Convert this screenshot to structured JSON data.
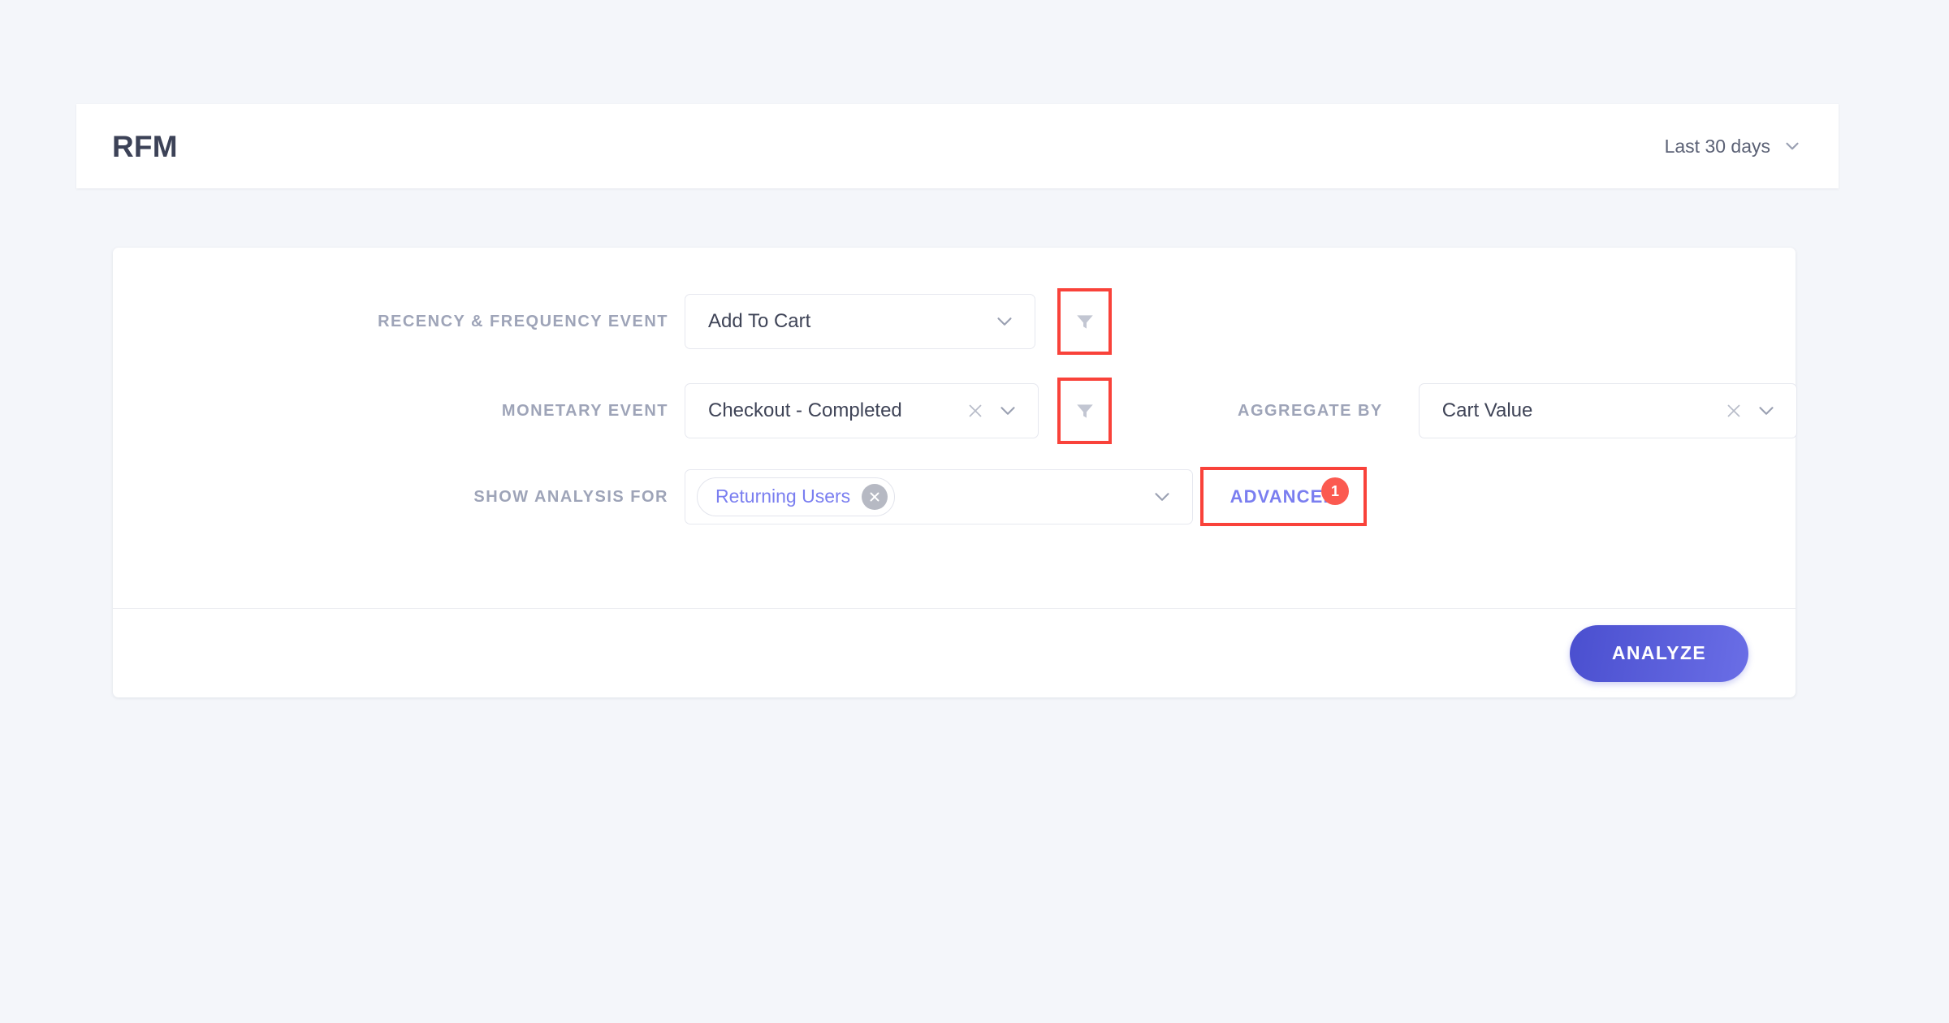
{
  "header": {
    "title": "RFM",
    "date_range": "Last 30 days",
    "date_range_icon": "chevron-down-icon"
  },
  "form": {
    "rows": [
      {
        "label": "RECENCY & FREQUENCY EVENT",
        "select_value": "Add To Cart",
        "has_clear": false,
        "filter_icon": "filter-funnel-icon",
        "filter_highlighted": true
      },
      {
        "label": "MONETARY EVENT",
        "select_value": "Checkout - Completed",
        "has_clear": true,
        "filter_icon": "filter-funnel-icon",
        "filter_highlighted": true
      },
      {
        "label": "SHOW ANALYSIS FOR",
        "chip_label": "Returning Users",
        "chip_remove_icon": "close-circle-icon"
      }
    ],
    "aggregate": {
      "label": "AGGREGATE BY",
      "select_value": "Cart Value",
      "has_clear": true
    },
    "advanced": {
      "label": "ADVANCED",
      "badge_count": "1",
      "highlighted": true
    }
  },
  "footer": {
    "analyze_label": "ANALYZE"
  },
  "colors": {
    "page_background": "#f4f6fa",
    "card_background": "#ffffff",
    "label_text": "#9ea4b8",
    "value_text": "#3f4457",
    "accent_indigo": "#7a7ef0",
    "primary_button": "#4a4fcf",
    "badge_red": "#fb5a50",
    "highlight_red": "#f9423a"
  }
}
